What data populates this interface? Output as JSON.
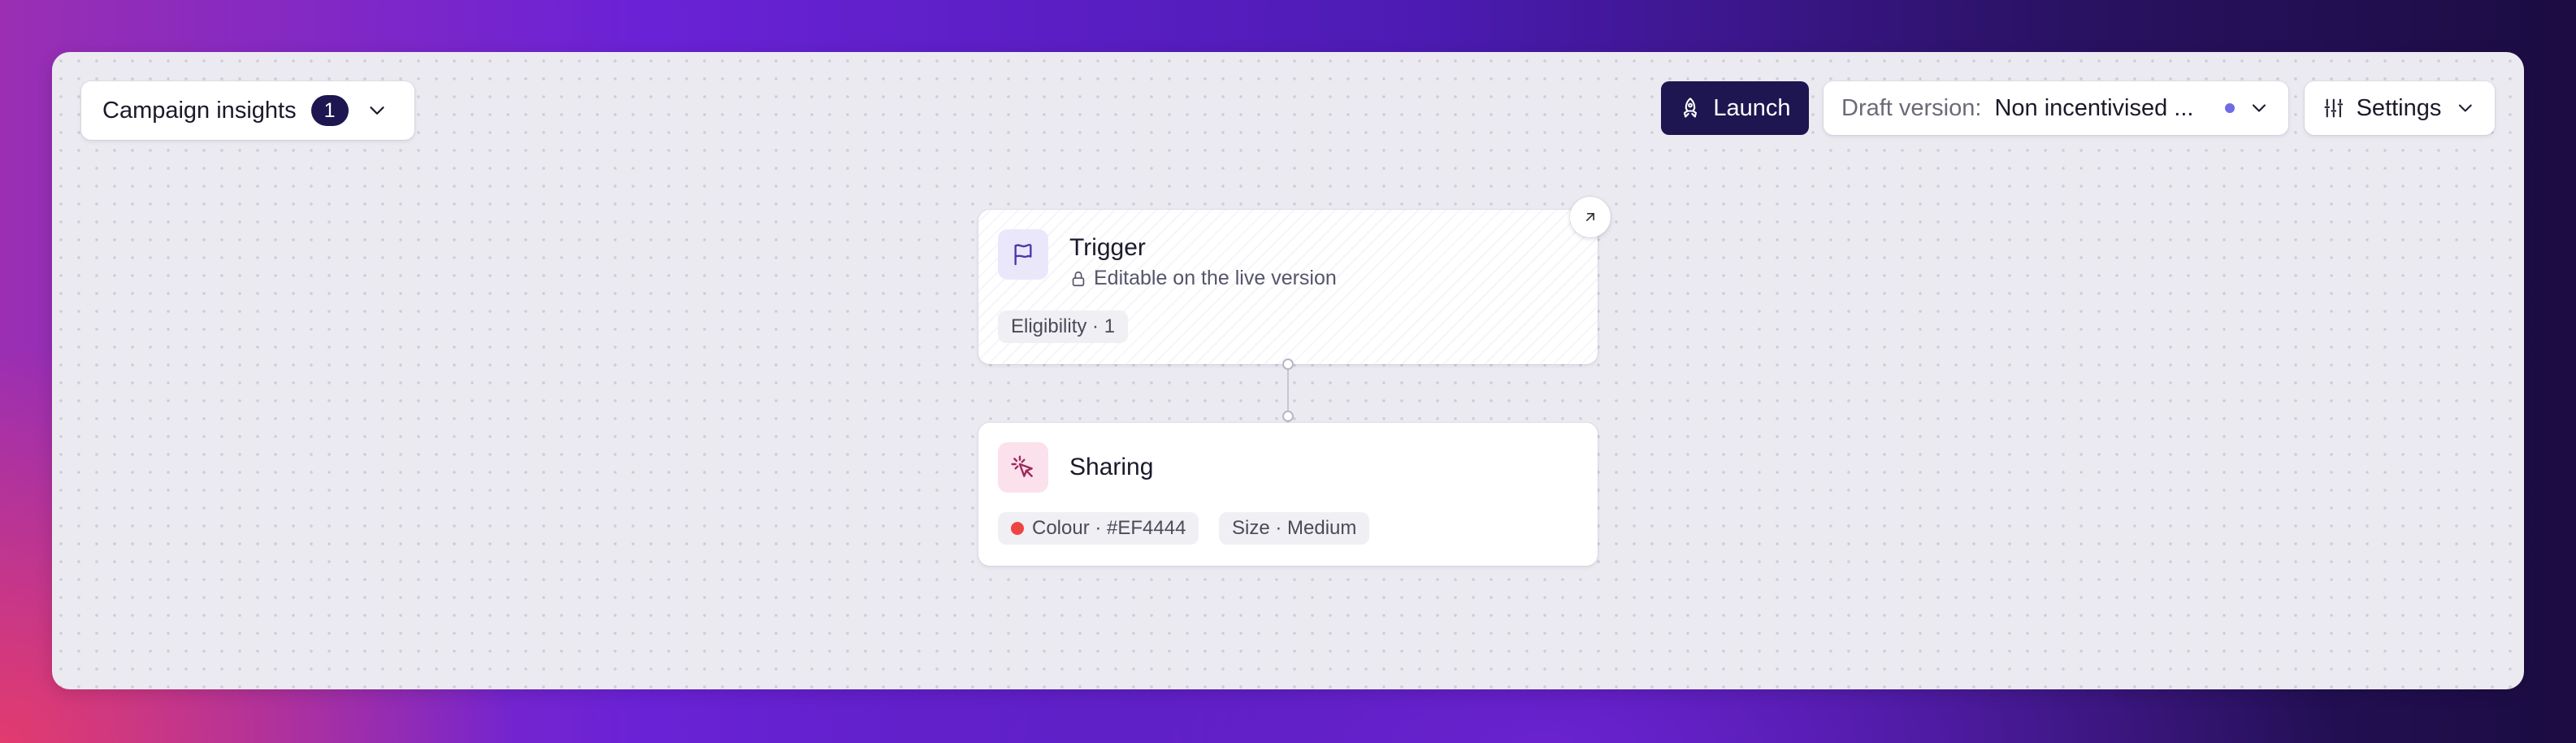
{
  "toolbar": {
    "insights_label": "Campaign insights",
    "insights_count": "1",
    "launch_label": "Launch",
    "draft_label": "Draft version:",
    "draft_value": "Non incentivised ...",
    "settings_label": "Settings"
  },
  "nodes": {
    "trigger": {
      "title": "Trigger",
      "subtitle": "Editable on the live version",
      "tag": "Eligibility · 1"
    },
    "sharing": {
      "title": "Sharing",
      "colour_tag": "Colour · #EF4444",
      "size_tag": "Size · Medium"
    }
  },
  "colors": {
    "accent_dark": "#1e1650",
    "colour_swatch": "#EF4444",
    "draft_status_dot": "#6f6be6"
  },
  "icons": [
    "chevron-down-icon",
    "rocket-icon",
    "sliders-icon",
    "flag-icon",
    "pointer-click-icon",
    "lock-icon",
    "arrow-up-right-icon"
  ]
}
